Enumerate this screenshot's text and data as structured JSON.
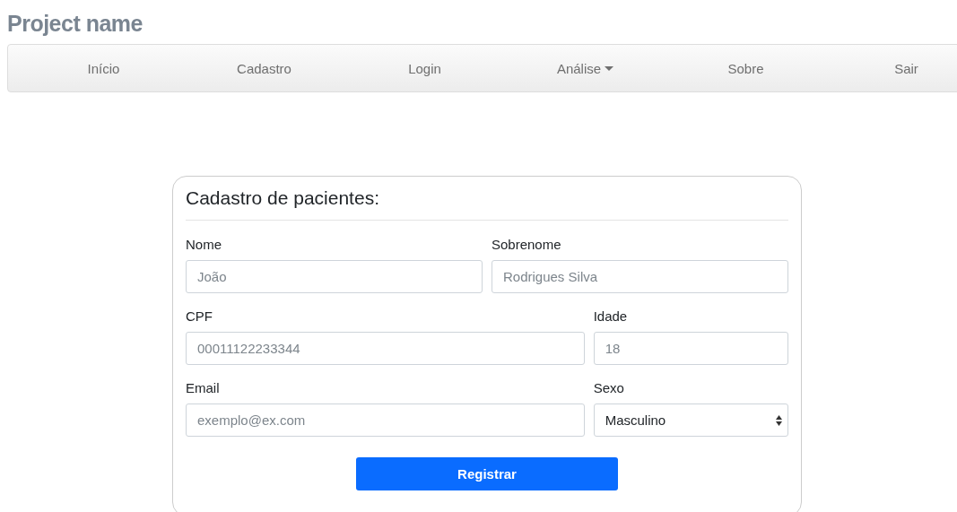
{
  "project_name": "Project name",
  "nav": [
    {
      "label": "Início",
      "kind": "link"
    },
    {
      "label": "Cadastro",
      "kind": "link"
    },
    {
      "label": "Login",
      "kind": "link"
    },
    {
      "label": "Análise",
      "kind": "dropdown"
    },
    {
      "label": "Sobre",
      "kind": "link"
    },
    {
      "label": "Sair",
      "kind": "link"
    }
  ],
  "form": {
    "title": "Cadastro de pacientes:",
    "rows": [
      [
        {
          "label": "Nome",
          "kind": "input",
          "placeholder": "João"
        },
        {
          "label": "Sobrenome",
          "kind": "input",
          "placeholder": "Rodrigues Silva"
        }
      ],
      [
        {
          "label": "CPF",
          "kind": "input",
          "placeholder": "00011122233344"
        },
        {
          "label": "Idade",
          "kind": "input",
          "placeholder": "18"
        }
      ],
      [
        {
          "label": "Email",
          "kind": "input",
          "placeholder": "exemplo@ex.com"
        },
        {
          "label": "Sexo",
          "kind": "select",
          "value": "Masculino"
        }
      ]
    ],
    "submit": "Registrar"
  }
}
